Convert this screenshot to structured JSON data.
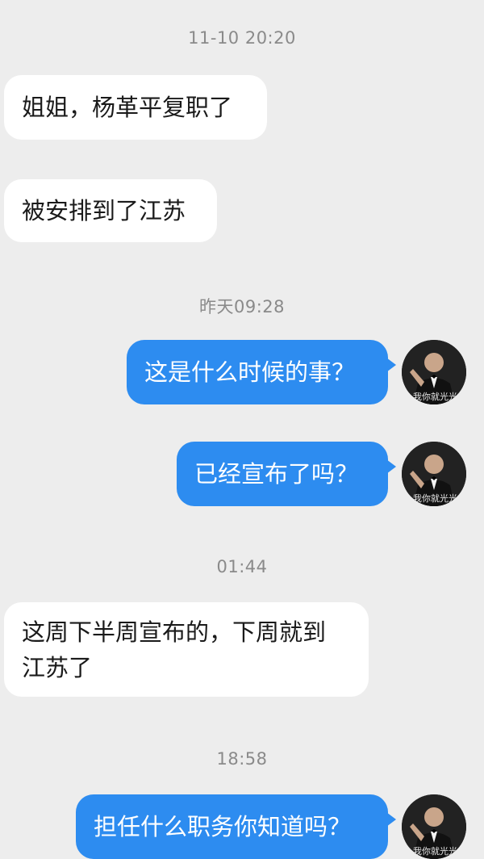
{
  "messages": [
    {
      "type": "time",
      "text": "11-10 20:20"
    },
    {
      "type": "incoming",
      "text": "姐姐，杨革平复职了"
    },
    {
      "type": "incoming",
      "text": "被安排到了江苏"
    },
    {
      "type": "time",
      "text": "昨天09:28"
    },
    {
      "type": "outgoing",
      "text": "这是什么时候的事？"
    },
    {
      "type": "outgoing",
      "text": "已经宣布了吗？"
    },
    {
      "type": "time",
      "text": "01:44"
    },
    {
      "type": "incoming",
      "line1": "这周下半周宣布的，下周就到",
      "line2": "江苏了"
    },
    {
      "type": "time",
      "text": "18:58"
    },
    {
      "type": "outgoing",
      "text": "担任什么职务你知道吗？"
    }
  ],
  "avatar": {
    "caption": "我你就光光",
    "icon": "user-avatar-photo"
  },
  "colors": {
    "background": "#ededed",
    "incoming_bubble": "#ffffff",
    "outgoing_bubble": "#2d8cf0",
    "timestamp_text": "#8a8a8a"
  }
}
